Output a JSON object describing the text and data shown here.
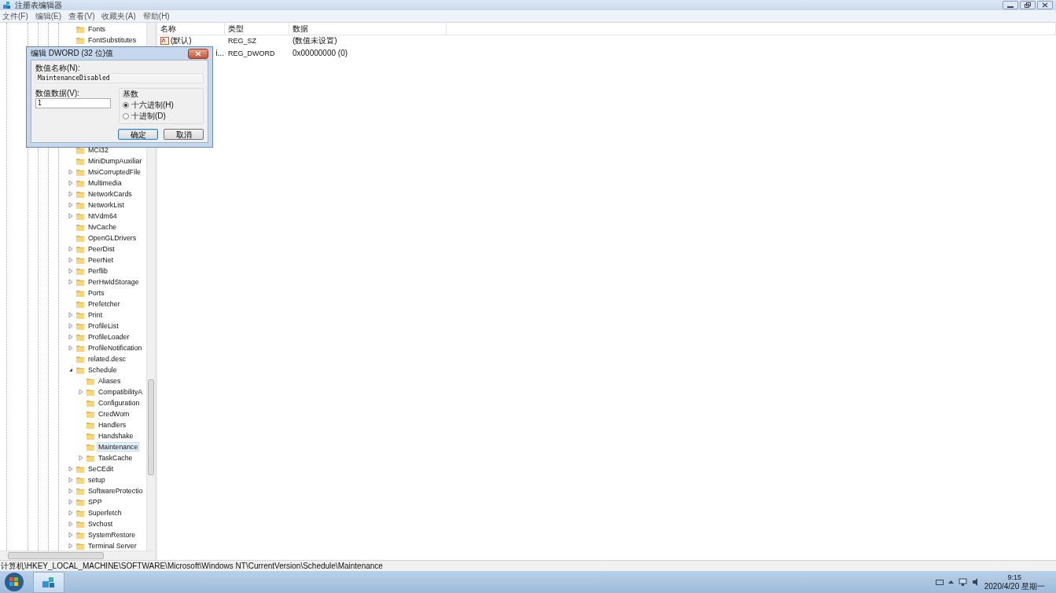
{
  "window": {
    "title": "注册表编辑器"
  },
  "menu": [
    "文件(F)",
    "编辑(E)",
    "查看(V)",
    "收藏夹(A)",
    "帮助(H)"
  ],
  "tree": [
    {
      "label": "Fonts",
      "kind": "leaf",
      "expanded": false,
      "selected": false
    },
    {
      "label": "FontSubstitutes",
      "kind": "leaf",
      "expanded": false,
      "selected": false
    },
    {
      "label": "MCI32",
      "kind": "leaf",
      "expanded": false,
      "selected": false
    },
    {
      "label": "MiniDumpAuxiliar",
      "kind": "leaf",
      "expanded": false,
      "selected": false
    },
    {
      "label": "MsiCorruptedFile",
      "kind": "branch",
      "expanded": false,
      "selected": false
    },
    {
      "label": "Multimedia",
      "kind": "branch",
      "expanded": false,
      "selected": false
    },
    {
      "label": "NetworkCards",
      "kind": "branch",
      "expanded": false,
      "selected": false
    },
    {
      "label": "NetworkList",
      "kind": "branch",
      "expanded": false,
      "selected": false
    },
    {
      "label": "NtVdm64",
      "kind": "branch",
      "expanded": false,
      "selected": false
    },
    {
      "label": "NvCache",
      "kind": "leaf",
      "expanded": false,
      "selected": false
    },
    {
      "label": "OpenGLDrivers",
      "kind": "leaf",
      "expanded": false,
      "selected": false
    },
    {
      "label": "PeerDist",
      "kind": "branch",
      "expanded": false,
      "selected": false
    },
    {
      "label": "PeerNet",
      "kind": "branch",
      "expanded": false,
      "selected": false
    },
    {
      "label": "Perflib",
      "kind": "branch",
      "expanded": false,
      "selected": false
    },
    {
      "label": "PerHwIdStorage",
      "kind": "branch",
      "expanded": false,
      "selected": false
    },
    {
      "label": "Ports",
      "kind": "leaf",
      "expanded": false,
      "selected": false
    },
    {
      "label": "Prefetcher",
      "kind": "leaf",
      "expanded": false,
      "selected": false
    },
    {
      "label": "Print",
      "kind": "branch",
      "expanded": false,
      "selected": false
    },
    {
      "label": "ProfileList",
      "kind": "branch",
      "expanded": false,
      "selected": false
    },
    {
      "label": "ProfileLoader",
      "kind": "branch",
      "expanded": false,
      "selected": false
    },
    {
      "label": "ProfileNotification",
      "kind": "branch",
      "expanded": false,
      "selected": false
    },
    {
      "label": "related.desc",
      "kind": "leaf",
      "expanded": false,
      "selected": false
    },
    {
      "label": "Schedule",
      "kind": "branch",
      "expanded": true,
      "selected": false,
      "children": [
        {
          "label": "Aliases",
          "kind": "leaf",
          "expanded": false,
          "selected": false
        },
        {
          "label": "CompatibilityA",
          "kind": "branch",
          "expanded": false,
          "selected": false
        },
        {
          "label": "Configuration",
          "kind": "leaf",
          "expanded": false,
          "selected": false
        },
        {
          "label": "CredWom",
          "kind": "leaf",
          "expanded": false,
          "selected": false
        },
        {
          "label": "Handlers",
          "kind": "leaf",
          "expanded": false,
          "selected": false
        },
        {
          "label": "Handshake",
          "kind": "leaf",
          "expanded": false,
          "selected": false
        },
        {
          "label": "Maintenance",
          "kind": "leaf",
          "expanded": false,
          "selected": true
        },
        {
          "label": "TaskCache",
          "kind": "branch",
          "expanded": false,
          "selected": false
        }
      ]
    },
    {
      "label": "SeCEdit",
      "kind": "branch",
      "expanded": false,
      "selected": false
    },
    {
      "label": "setup",
      "kind": "branch",
      "expanded": false,
      "selected": false
    },
    {
      "label": "SoftwareProtectio",
      "kind": "branch",
      "expanded": false,
      "selected": false
    },
    {
      "label": "SPP",
      "kind": "branch",
      "expanded": false,
      "selected": false
    },
    {
      "label": "Superfetch",
      "kind": "branch",
      "expanded": false,
      "selected": false
    },
    {
      "label": "Svchost",
      "kind": "branch",
      "expanded": false,
      "selected": false
    },
    {
      "label": "SystemRestore",
      "kind": "branch",
      "expanded": false,
      "selected": false
    },
    {
      "label": "Terminal Server",
      "kind": "branch",
      "expanded": false,
      "selected": false
    }
  ],
  "values": {
    "columns": [
      "名称",
      "类型",
      "数据"
    ],
    "rows": [
      {
        "name": "(默认)",
        "kind": "string",
        "type": "REG_SZ",
        "data": "(数值未设置)"
      },
      {
        "name": "i...",
        "kind": "dword",
        "type": "REG_DWORD",
        "data": "0x00000000 (0)"
      }
    ]
  },
  "dialog": {
    "title": "编辑 DWORD (32 位)值",
    "name_label": "数值名称(N):",
    "name_value": "MaintenanceDisabled",
    "data_label": "数值数据(V):",
    "data_value": "1",
    "base_label": "基数",
    "radios": [
      {
        "label": "十六进制(H)",
        "selected": true
      },
      {
        "label": "十进制(D)",
        "selected": false
      }
    ],
    "buttons": [
      "确定",
      "取消"
    ]
  },
  "status_bar": "计算机\\HKEY_LOCAL_MACHINE\\SOFTWARE\\Microsoft\\Windows NT\\CurrentVersion\\Schedule\\Maintenance",
  "taskbar": {
    "time": "9:15",
    "date": "2020/4/20 星期一"
  }
}
